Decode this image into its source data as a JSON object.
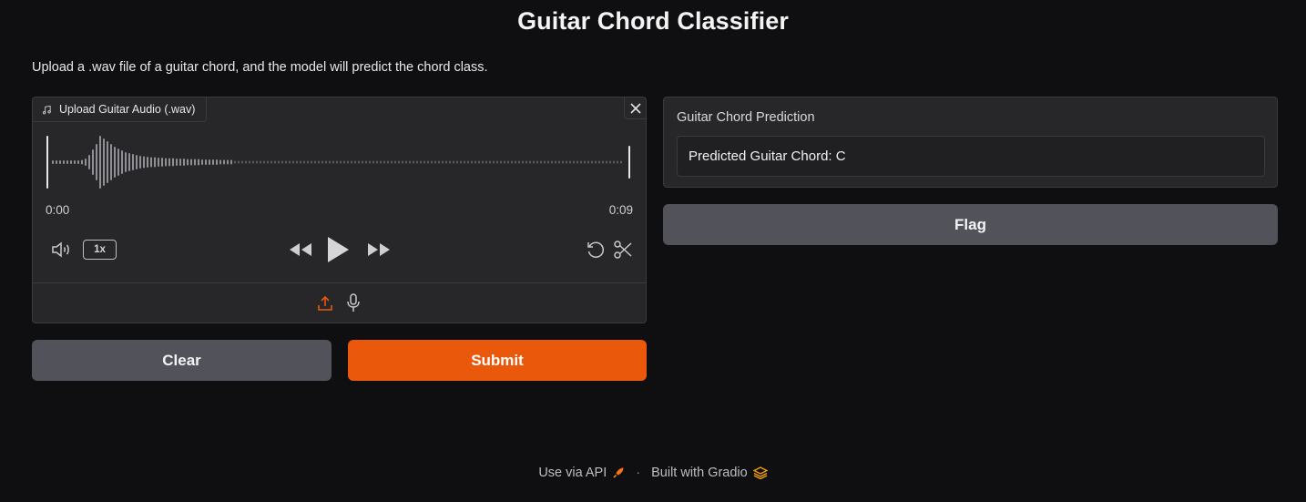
{
  "app": {
    "title": "Guitar Chord Classifier",
    "description": "Upload a .wav file of a guitar chord, and the model will predict the chord class."
  },
  "audio_input": {
    "label": "Upload Guitar Audio (.wav)",
    "time_current": "0:00",
    "time_total": "0:09",
    "playback_speed": "1x",
    "icons": [
      "music-note-icon",
      "close-icon",
      "volume-icon",
      "rewind-icon",
      "play-icon",
      "fast-forward-icon",
      "undo-icon",
      "scissors-icon",
      "upload-icon",
      "microphone-icon"
    ]
  },
  "buttons": {
    "clear": "Clear",
    "submit": "Submit",
    "flag": "Flag"
  },
  "output": {
    "label": "Guitar Chord Prediction",
    "value": "Predicted Guitar Chord: C"
  },
  "footer": {
    "api_link": "Use via API",
    "separator": "·",
    "built_with": "Built with Gradio"
  },
  "colors": {
    "accent": "#ea580c",
    "background": "#0f0f11",
    "panel": "#27272a",
    "secondary_button": "#52525b"
  }
}
